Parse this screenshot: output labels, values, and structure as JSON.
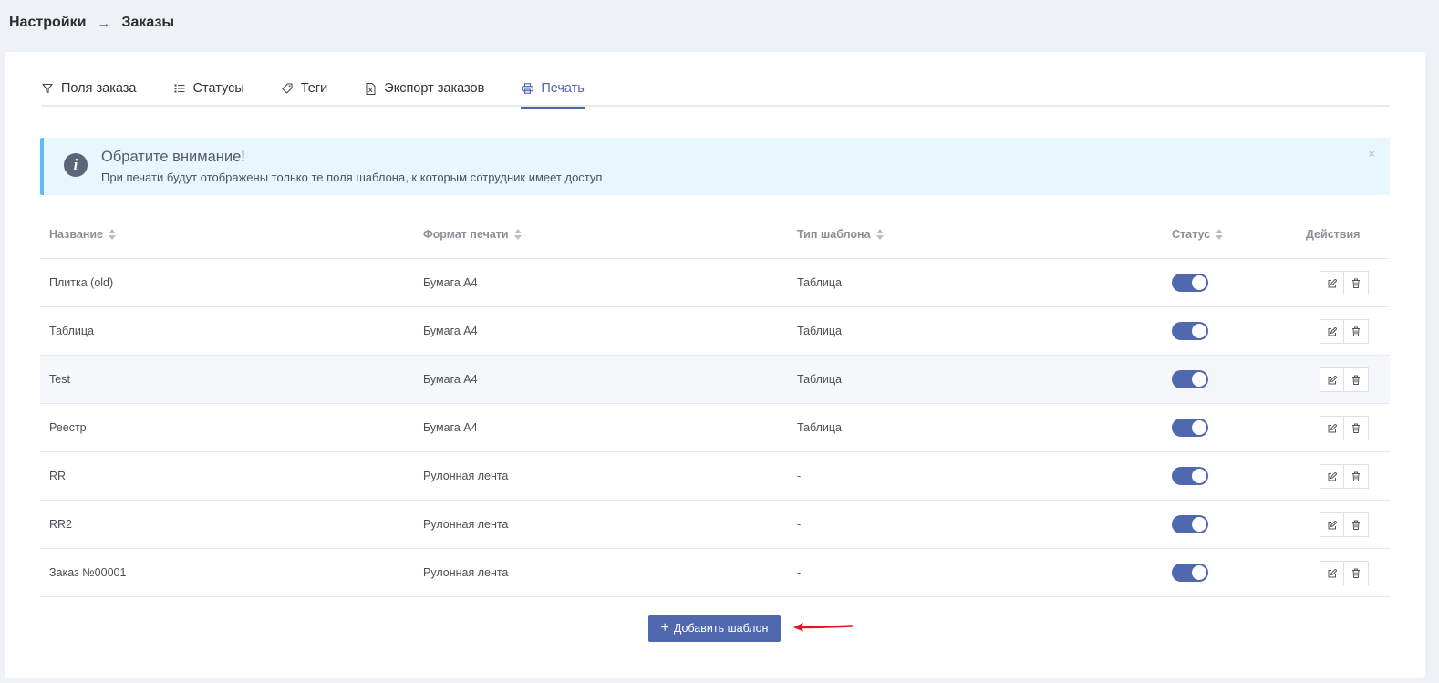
{
  "breadcrumb": {
    "parent": "Настройки",
    "separator": "→",
    "current": "Заказы"
  },
  "tabs": [
    {
      "label": "Поля заказа",
      "icon": "filter-icon",
      "active": false
    },
    {
      "label": "Статусы",
      "icon": "list-icon",
      "active": false
    },
    {
      "label": "Теги",
      "icon": "tag-icon",
      "active": false
    },
    {
      "label": "Экспорт заказов",
      "icon": "excel-file-icon",
      "active": false
    },
    {
      "label": "Печать",
      "icon": "printer-icon",
      "active": true
    }
  ],
  "alert": {
    "title": "Обратите внимание!",
    "text": "При печати будут отображены только те поля шаблона, к которым сотрудник имеет доступ",
    "close": "×"
  },
  "table": {
    "headers": {
      "name": "Название",
      "format": "Формат печати",
      "type": "Тип шаблона",
      "status": "Статус",
      "actions": "Действия"
    },
    "rows": [
      {
        "name": "Плитка (old)",
        "format": "Бумага А4",
        "type": "Таблица",
        "status_on": true
      },
      {
        "name": "Таблица",
        "format": "Бумага А4",
        "type": "Таблица",
        "status_on": true
      },
      {
        "name": "Test",
        "format": "Бумага А4",
        "type": "Таблица",
        "status_on": true
      },
      {
        "name": "Реестр",
        "format": "Бумага А4",
        "type": "Таблица",
        "status_on": true
      },
      {
        "name": "RR",
        "format": "Рулонная лента",
        "type": "-",
        "status_on": true
      },
      {
        "name": "RR2",
        "format": "Рулонная лента",
        "type": "-",
        "status_on": true
      },
      {
        "name": "Заказ №00001",
        "format": "Рулонная лента",
        "type": "-",
        "status_on": true
      }
    ]
  },
  "add_button": {
    "plus": "+",
    "label": "Добавить шаблон"
  },
  "colors": {
    "accent": "#5069ae",
    "alert_bg": "#e8f6fe",
    "alert_border": "#5bbdf3",
    "annotation_arrow": "#e8141c"
  }
}
